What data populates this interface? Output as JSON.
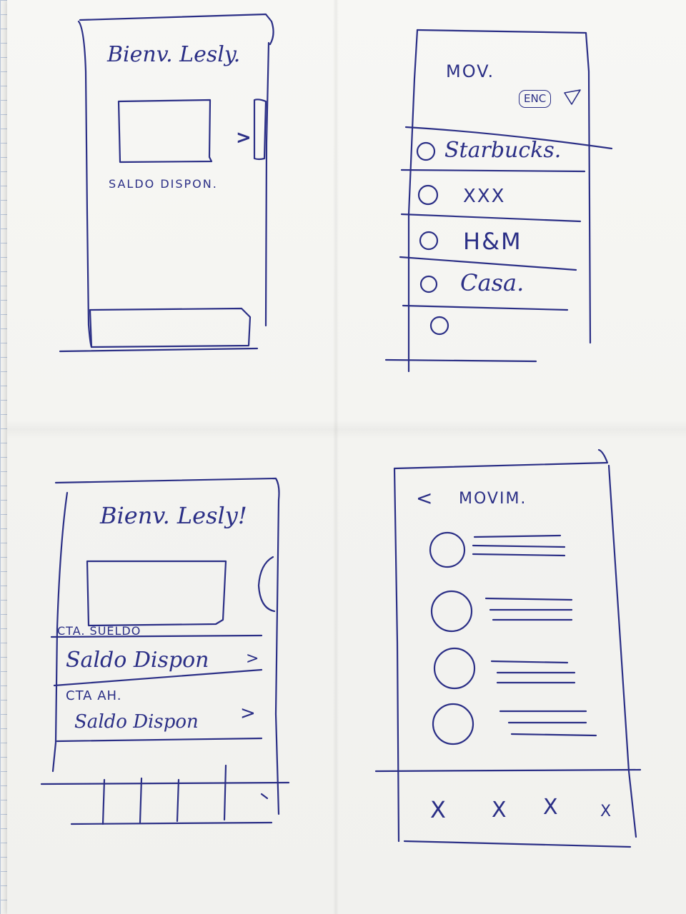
{
  "screens": {
    "home_a": {
      "greeting": "Bienv. Lesly.",
      "balance_label": "SALDO DISPON.",
      "next_arrow": ">"
    },
    "movements_a": {
      "title": "MOV.",
      "badge": "ENC",
      "items": [
        {
          "label": "Starbucks."
        },
        {
          "label": "XXX"
        },
        {
          "label": "H&M"
        },
        {
          "label": "Casa."
        },
        {
          "label": ""
        }
      ]
    },
    "home_b": {
      "greeting": "Bienv. Lesly!",
      "account_1_name": "CTA. SUELDO",
      "account_1_balance": "Saldo Dispon",
      "account_2_name": "CTA AH.",
      "account_2_balance": "Saldo Dispon",
      "chevron": ">"
    },
    "movements_b": {
      "back": "<",
      "title": "MOVIM.",
      "tab_marks": [
        "X",
        "X",
        "X",
        "X"
      ]
    }
  },
  "ink_color": "#2b2f86"
}
